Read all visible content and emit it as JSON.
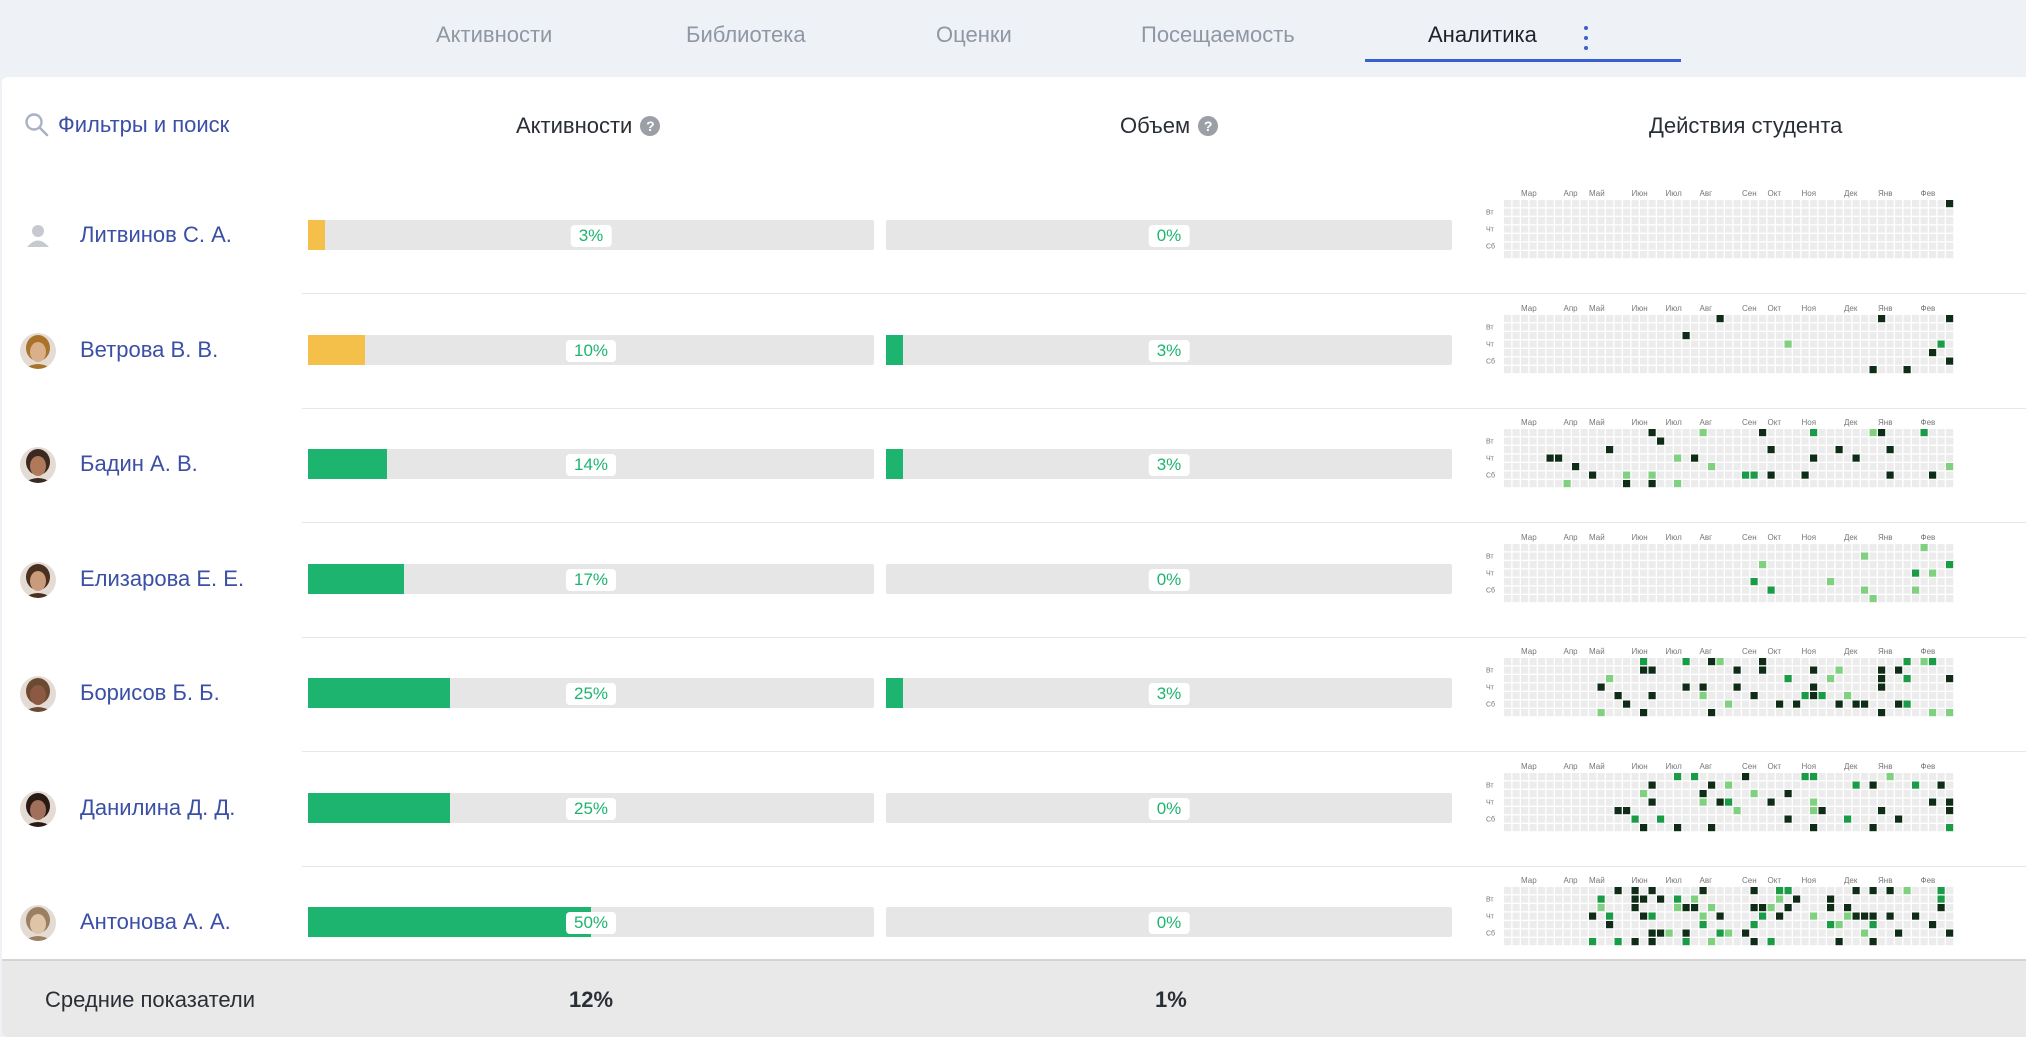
{
  "tabs": [
    {
      "label": "Активности",
      "active": false
    },
    {
      "label": "Библиотека",
      "active": false
    },
    {
      "label": "Оценки",
      "active": false
    },
    {
      "label": "Посещаемость",
      "active": false
    },
    {
      "label": "Аналитика",
      "active": true
    }
  ],
  "toolbar": {
    "filter_label": "Фильтры и поиск",
    "filter_icon": "search-icon",
    "more_icon": "vertical-dots-icon"
  },
  "columns": {
    "activity": "Активности",
    "volume": "Объем",
    "actions": "Действия студента",
    "help_glyph": "?"
  },
  "heatmap": {
    "months": [
      "Мар",
      "Апр",
      "Май",
      "Июн",
      "Июл",
      "Авг",
      "Сен",
      "Окт",
      "Ноя",
      "Дек",
      "Янв",
      "Фев"
    ],
    "days": [
      "Вт",
      "Чт",
      "Сб"
    ]
  },
  "colors": {
    "activity_low": "#f5c04a",
    "activity_ok": "#1db46f",
    "volume": "#1db46f",
    "heat_empty": "#ececec",
    "heat_dark": "#0f2c16",
    "heat_mid": "#1a9c47",
    "heat_light": "#7fd07f",
    "link": "#3a4fa5"
  },
  "students": [
    {
      "name": "Литвинов С. А.",
      "avatar": "person-placeholder-icon",
      "activity": 3,
      "activity_label": "3%",
      "activity_color": "low",
      "volume": 0,
      "volume_label": "0%"
    },
    {
      "name": "Ветрова В. В.",
      "avatar": "student-photo",
      "activity": 10,
      "activity_label": "10%",
      "activity_color": "low",
      "volume": 3,
      "volume_label": "3%"
    },
    {
      "name": "Бадин А. В.",
      "avatar": "student-photo",
      "activity": 14,
      "activity_label": "14%",
      "activity_color": "ok",
      "volume": 3,
      "volume_label": "3%"
    },
    {
      "name": "Елизарова Е. Е.",
      "avatar": "student-photo",
      "activity": 17,
      "activity_label": "17%",
      "activity_color": "ok",
      "volume": 0,
      "volume_label": "0%"
    },
    {
      "name": "Борисов Б. Б.",
      "avatar": "student-photo",
      "activity": 25,
      "activity_label": "25%",
      "activity_color": "ok",
      "volume": 3,
      "volume_label": "3%"
    },
    {
      "name": "Данилина Д. Д.",
      "avatar": "student-photo",
      "activity": 25,
      "activity_label": "25%",
      "activity_color": "ok",
      "volume": 0,
      "volume_label": "0%"
    },
    {
      "name": "Антонова А. А.",
      "avatar": "student-photo",
      "activity": 50,
      "activity_label": "50%",
      "activity_color": "ok",
      "volume": 0,
      "volume_label": "0%"
    }
  ],
  "footer": {
    "label": "Средние показатели",
    "activity_avg": "12%",
    "volume_avg": "1%"
  }
}
